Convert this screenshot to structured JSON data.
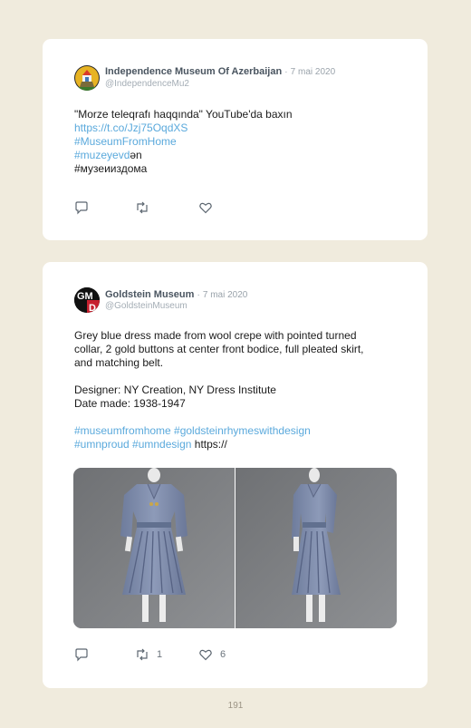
{
  "page_number": "191",
  "colors": {
    "background": "#f0ebdd",
    "link": "#5aa9dc",
    "card": "#ffffff"
  },
  "tweets": [
    {
      "author": "Independence Museum Of Azerbaijan",
      "separator": "·",
      "date": "7 mai 2020",
      "handle": "@IndependenceMu2",
      "avatar_icon": "museum-tower-avatar",
      "text": {
        "line1": "\"Morze teleqrafı haqqında\" YouTube'da baxın",
        "link1": "https://t.co/Jzj75OqdXS",
        "hashtag1": "#MuseumFromHome",
        "hashtag2": "#muzeyevd",
        "hashtag2_suffix": "ən",
        "line5": "#музеииздома"
      },
      "actions": {
        "reply_icon": "reply-icon",
        "retweet_icon": "retweet-icon",
        "like_icon": "heart-icon"
      }
    },
    {
      "author": "Goldstein Museum",
      "separator": "·",
      "date": "7 mai 2020",
      "handle": "@GoldsteinMuseum",
      "avatar_text": "GMD",
      "text": {
        "p1_l1": "Grey blue dress made from wool crepe with pointed turned",
        "p1_l2": "collar, 2 gold buttons at center front bodice, full pleated skirt,",
        "p1_l3": "and matching belt.",
        "designer": "Designer: NY Creation, NY Dress Institute",
        "date_made": "Date made: 1938-1947",
        "hashtags_l1": "#museumfromhome #goldsteinrhymeswithdesign",
        "hashtags_l2": "#umnproud #umndesign",
        "trailing": "https://"
      },
      "images": [
        "grey-blue-dress-front-photo",
        "grey-blue-dress-side-photo"
      ],
      "actions": {
        "retweets": "1",
        "likes": "6"
      }
    }
  ]
}
